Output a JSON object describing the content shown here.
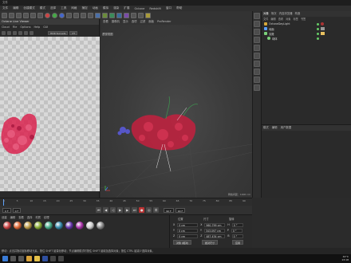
{
  "window": {
    "title": "文件"
  },
  "menu": [
    "文件",
    "编辑",
    "创建模式",
    "模式",
    "选择",
    "工具",
    "网格",
    "捕捉",
    "动画",
    "模拟",
    "渲染",
    "扩展",
    "Octane",
    "Redshift",
    "窗口",
    "帮助"
  ],
  "octane": {
    "title": "Octane Live Viewer",
    "menu": [
      "Cloud",
      "File",
      "Options",
      "Help",
      "GUI"
    ],
    "combo": "HDR Sunsets",
    "combo2": "PT",
    "status": "Rendering: 100.000 %  Ms/sec: 7.024  Time: 00:00:00:00/00:00:00:00  Spp/maxspp: 1024/1024  Tri: 0/  Mesh: 1  Hair: 0  RTX:on  GPU: 43°C"
  },
  "viewport": {
    "menu": [
      "查看",
      "摄像机",
      "显示",
      "选项",
      "过滤",
      "面板",
      "ProRender"
    ],
    "label": "透视视图",
    "scale": "网格间距：1000 cm"
  },
  "object_manager": {
    "tabs": [
      "对象",
      "场次",
      "内容浏览器",
      "构造"
    ],
    "menu": [
      "文件",
      "编辑",
      "查看",
      "对象",
      "标签",
      "书签"
    ],
    "rows": [
      {
        "name": "OctaneDayLight",
        "color": "#d6a83a"
      },
      {
        "name": "地面",
        "color": "#5aa0ff"
      },
      {
        "name": "克隆",
        "color": "#7ad27a"
      },
      {
        "name": "球体",
        "color": "#7ad27a"
      }
    ]
  },
  "attribute_manager": {
    "tabs": [
      "模式",
      "编辑",
      "用户数据"
    ]
  },
  "timeline": {
    "ticks": [
      "0",
      "5",
      "10",
      "15",
      "20",
      "25",
      "30",
      "35",
      "40",
      "45",
      "50",
      "55",
      "60",
      "65",
      "70",
      "75",
      "80",
      "85",
      "90"
    ],
    "end": "0 F"
  },
  "transport": {
    "start": "0 F",
    "current": "0 F",
    "end": "90 F",
    "end2": "90 F"
  },
  "materials": {
    "menu": [
      "创建",
      "编辑",
      "查看",
      "选择",
      "材质",
      "纹理"
    ]
  },
  "coordinates": {
    "heads": [
      "位置",
      "尺寸",
      "旋转"
    ],
    "rows": [
      {
        "axis": "X",
        "pos": "0 cm",
        "size_label": "X",
        "size": "960.799 cm",
        "rot_label": "H",
        "rot": "0 °"
      },
      {
        "axis": "Y",
        "pos": "0 cm",
        "size_label": "Y",
        "size": "343.097 cm",
        "rot_label": "P",
        "rot": "0 °"
      },
      {
        "axis": "Z",
        "pos": "0 cm",
        "size_label": "Z",
        "size": "487.434 cm",
        "rot_label": "B",
        "rot": "0 °"
      }
    ],
    "mode1": "对象 (相对)",
    "mode2": "绝对尺寸",
    "apply": "应用"
  },
  "status_bar": "移动：点击并拖动鼠标移动元素。按住 SHIFT 键量化移动；节点编辑模式时按住 SHIFT 键增加选择对象；按住 CTRL 键减少选择对象。",
  "taskbar": {
    "temp": "42°C",
    "time": "13:18",
    "date": "2023/5/8"
  }
}
